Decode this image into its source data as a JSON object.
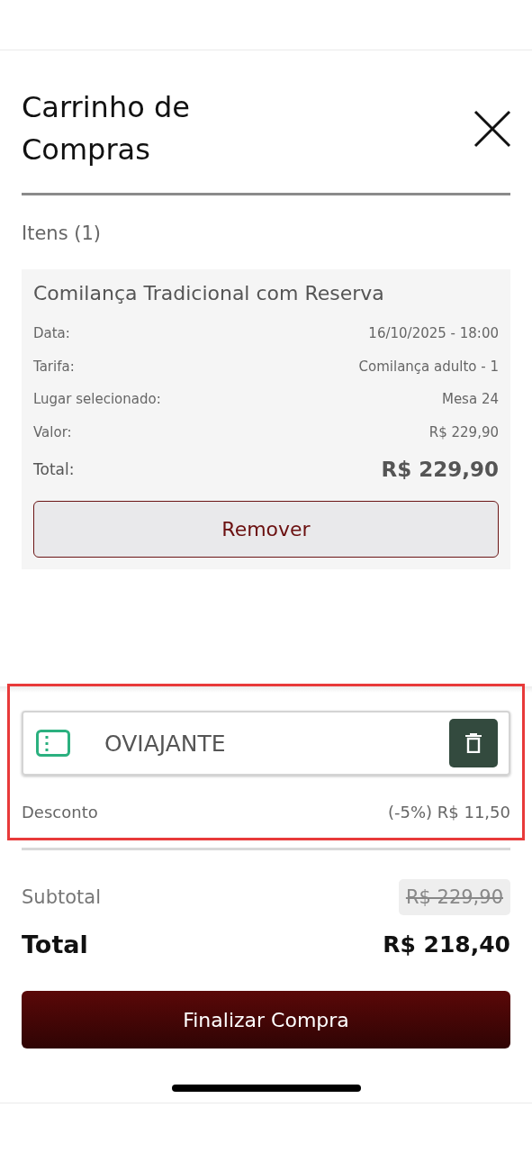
{
  "header": {
    "title": "Carrinho de Compras"
  },
  "items_heading": "Itens (1)",
  "items": [
    {
      "title": "Comilança Tradicional com Reserva",
      "details": [
        {
          "label": "Data:",
          "value": "16/10/2025 - 18:00"
        },
        {
          "label": "Tarifa:",
          "value": "Comilança adulto - 1"
        },
        {
          "label": "Lugar selecionado:",
          "value": "Mesa 24"
        },
        {
          "label": "Valor:",
          "value": "R$ 229,90"
        }
      ],
      "total_label": "Total:",
      "total_value": "R$ 229,90",
      "remove_button": "Remover"
    }
  ],
  "coupon": {
    "value": "OVIAJANTE",
    "discount_label": "Desconto",
    "discount_value": "(-5%) R$ 11,50"
  },
  "summary": {
    "subtotal_label": "Subtotal",
    "subtotal_value": "R$ 229,90",
    "total_label": "Total",
    "total_value": "R$ 218,40"
  },
  "checkout_button": "Finalizar Compra"
}
